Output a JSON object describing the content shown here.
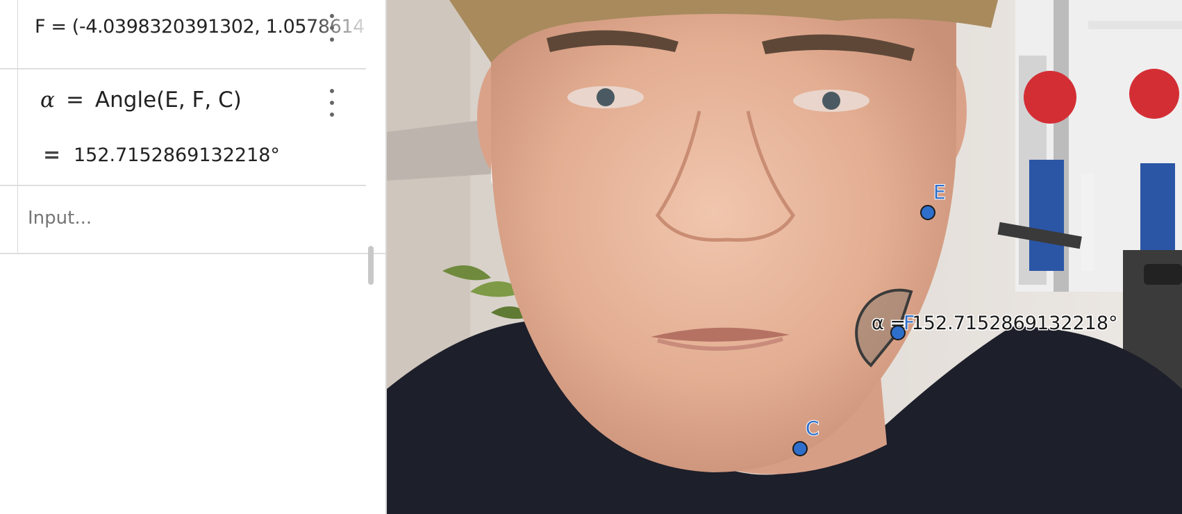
{
  "algebra": {
    "f_definition": "F = (-4.0398320391302, 1.0578614",
    "alpha_symbol": "α",
    "alpha_equals": "=",
    "alpha_command": "Angle(E, F, C)",
    "alpha_result_sign": "=",
    "alpha_value": "152.7152869132218°",
    "input_placeholder": "Input..."
  },
  "graphics": {
    "points": [
      {
        "name": "E",
        "label": "E"
      },
      {
        "name": "F",
        "label": "F"
      },
      {
        "name": "C",
        "label": "C"
      }
    ],
    "angle_label": "α = 152.7152869132218°",
    "point_color": "#2e6fcb",
    "label_color": "#2e6fcb",
    "angle_fill_color": "#8c7b6e"
  },
  "icons": {
    "row_menu": "kebab-vertical-icon"
  }
}
